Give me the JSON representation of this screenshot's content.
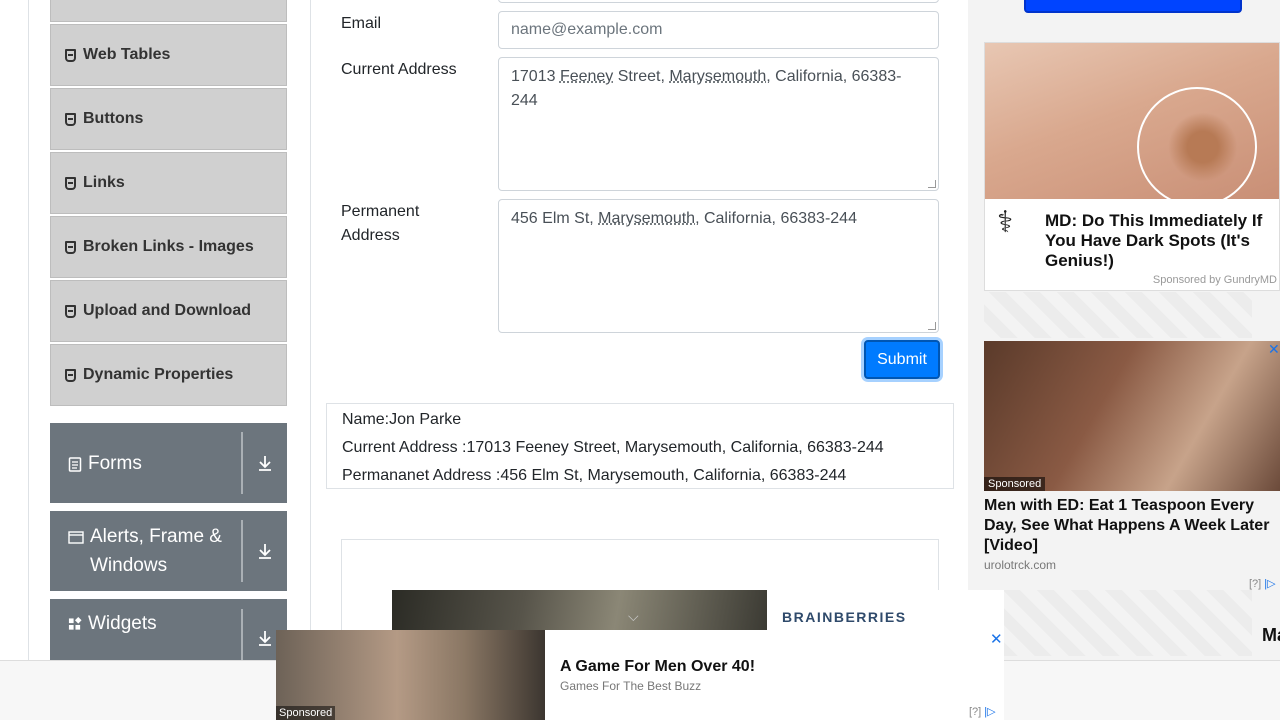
{
  "sidebar": {
    "menu_items": [
      {
        "label": "Web Tables"
      },
      {
        "label": "Buttons"
      },
      {
        "label": "Links"
      },
      {
        "label": "Broken Links - Images"
      },
      {
        "label": "Upload and Download"
      },
      {
        "label": "Dynamic Properties"
      }
    ],
    "groups": [
      {
        "label": "Forms"
      },
      {
        "label": "Alerts, Frame & Windows"
      },
      {
        "label": "Widgets"
      }
    ]
  },
  "form": {
    "email_label": "Email",
    "email_placeholder": "name@example.com",
    "current_address_label": "Current Address",
    "current_address_parts": [
      "17013 ",
      "Feeney",
      " Street, ",
      "Marysemouth",
      ", California, 66383-244"
    ],
    "permanent_address_label": "Permanent Address",
    "permanent_address_parts": [
      "456 Elm St, ",
      "Marysemouth",
      ", California, 66383-244"
    ],
    "submit_label": "Submit"
  },
  "output": {
    "name_line": "Name:Jon Parke",
    "current_line": "Current Address :17013 Feeney Street, Marysemouth, California, 66383-244",
    "permanent_line": "Permananet Address :456 Elm St, Marysemouth, California, 66383-244"
  },
  "ads": {
    "ad1_title": "MD: Do This Immediately If You Have Dark Spots (It's Genius!)",
    "ad1_sponsor": "Sponsored by GundryMD",
    "ad2_tag": "Sponsored",
    "ad2_title": "Men with ED: Eat 1 Teaspoon Every Day, See What Happens A Week Later [Video]",
    "ad2_source": "urolotrck.com",
    "ad2_info": "[?]",
    "made_partial": "Made",
    "brainberries": "BRAINBERRIES",
    "bottom_title": "A Game For Men Over 40!",
    "bottom_source": "Games For The Best Buzz",
    "bottom_tag": "Sponsored",
    "bottom_info": "[?]",
    "close_symbol": "✕"
  }
}
